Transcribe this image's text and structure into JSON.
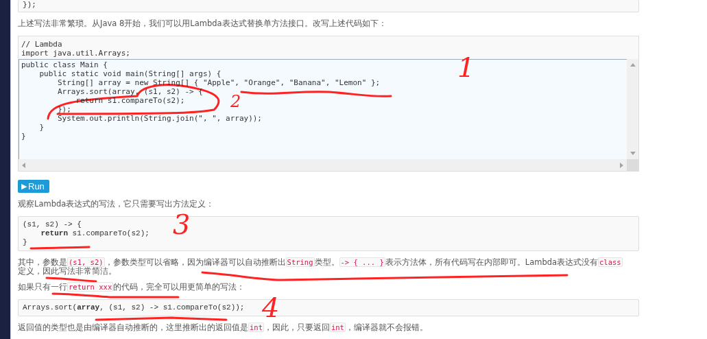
{
  "blocks": [
    {
      "kind": "code_tail",
      "lines": [
        "});"
      ]
    },
    {
      "kind": "para",
      "lines": [
        [
          {
            "kind": "text",
            "text": "上述写法非常繁琐。从Java 8开始，我们可以用Lambda表达式替换单方法接口。改写上述代码如下："
          }
        ]
      ]
    },
    {
      "kind": "editor",
      "header_lines": [
        "// Lambda",
        "import java.util.Arrays;"
      ],
      "lines": [
        "public class Main {",
        "    public static void main(String[] args) {",
        "        String[] array = new String[] { \"Apple\", \"Orange\", \"Banana\", \"Lemon\" };",
        "        Arrays.sort(array, (s1, s2) -> {",
        "            return s1.compareTo(s2);",
        "        });",
        "        System.out.println(String.join(\", \", array));",
        "    }",
        "}"
      ]
    },
    {
      "kind": "button",
      "icon": "▶",
      "label": "Run"
    },
    {
      "kind": "para",
      "lines": [
        [
          {
            "kind": "text",
            "text": "观察Lambda表达式的写法，它只需要写出方法定义："
          }
        ]
      ]
    },
    {
      "kind": "code",
      "lines": [
        "(s1, s2) -> {",
        "    **return** s1.compareTo(s2);",
        "}"
      ]
    },
    {
      "kind": "para",
      "lines": [
        [
          {
            "kind": "text",
            "text": "其中，参数是"
          },
          {
            "kind": "code",
            "text": "(s1, s2)"
          },
          {
            "kind": "text",
            "text": "，参数类型可以省略，因为编译器可以自动推断出"
          },
          {
            "kind": "code",
            "text": "String"
          },
          {
            "kind": "text",
            "text": "类型。"
          },
          {
            "kind": "code",
            "text": "-> { ... }"
          },
          {
            "kind": "text",
            "text": "表示方法体，所有代码写在内部即可。Lambda表达式没有"
          },
          {
            "kind": "code",
            "text": "class"
          }
        ],
        [
          {
            "kind": "text",
            "text": "定义，因此写法非常简洁。"
          }
        ]
      ]
    },
    {
      "kind": "para",
      "lines": [
        [
          {
            "kind": "text",
            "text": "如果只有一行"
          },
          {
            "kind": "code",
            "text": "return xxx"
          },
          {
            "kind": "text",
            "text": "的代码，完全可以用更简单的写法："
          }
        ]
      ]
    },
    {
      "kind": "code",
      "lines": [
        "Arrays.sort(**array**, (s1, s2) -> s1.compareTo(s2));"
      ]
    },
    {
      "kind": "para",
      "lines": [
        [
          {
            "kind": "text",
            "text": "返回值的类型也是由编译器自动推断的，这里推断出的返回值是"
          },
          {
            "kind": "code",
            "text": "int"
          },
          {
            "kind": "text",
            "text": "，因此，只要返回"
          },
          {
            "kind": "code",
            "text": "int"
          },
          {
            "kind": "text",
            "text": "，编译器就不会报错。"
          }
        ]
      ]
    }
  ],
  "annotations": [
    {
      "text": "1"
    },
    {
      "text": "2"
    },
    {
      "text": "3"
    },
    {
      "text": "4"
    }
  ]
}
